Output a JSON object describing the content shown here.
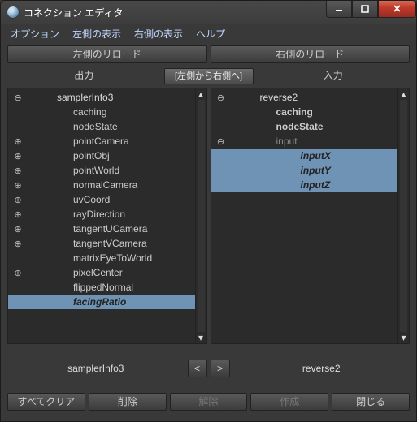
{
  "window": {
    "title": "コネクション エディタ"
  },
  "menu": {
    "options": "オプション",
    "left_display": "左側の表示",
    "right_display": "右側の表示",
    "help": "ヘルプ"
  },
  "toolbar": {
    "reload_left": "左側のリロード",
    "reload_right": "右側のリロード"
  },
  "columns": {
    "left": "出力",
    "center": "[左側から右側へ]",
    "right": "入力"
  },
  "left": {
    "node": "samplerInfo3",
    "attrs": [
      {
        "name": "caching",
        "exp": "",
        "bold": false
      },
      {
        "name": "nodeState",
        "exp": "",
        "bold": false
      },
      {
        "name": "pointCamera",
        "exp": "⊕",
        "bold": false
      },
      {
        "name": "pointObj",
        "exp": "⊕",
        "bold": false
      },
      {
        "name": "pointWorld",
        "exp": "⊕",
        "bold": false
      },
      {
        "name": "normalCamera",
        "exp": "⊕",
        "bold": false
      },
      {
        "name": "uvCoord",
        "exp": "⊕",
        "bold": false
      },
      {
        "name": "rayDirection",
        "exp": "⊕",
        "bold": false
      },
      {
        "name": "tangentUCamera",
        "exp": "⊕",
        "bold": false
      },
      {
        "name": "tangentVCamera",
        "exp": "⊕",
        "bold": false
      },
      {
        "name": "matrixEyeToWorld",
        "exp": "",
        "bold": false
      },
      {
        "name": "pixelCenter",
        "exp": "⊕",
        "bold": false
      },
      {
        "name": "flippedNormal",
        "exp": "",
        "bold": false
      },
      {
        "name": "facingRatio",
        "exp": "",
        "bold": true,
        "selected": true
      }
    ]
  },
  "right": {
    "node": "reverse2",
    "attrs": [
      {
        "name": "caching",
        "exp": "",
        "bold": true
      },
      {
        "name": "nodeState",
        "exp": "",
        "bold": true
      },
      {
        "name": "input",
        "exp": "⊖",
        "bold": false,
        "grey": true
      },
      {
        "name": "inputX",
        "sub": true,
        "selected": true
      },
      {
        "name": "inputY",
        "sub": true,
        "selected": true
      },
      {
        "name": "inputZ",
        "sub": true,
        "selected": true
      }
    ]
  },
  "footer": {
    "left_node": "samplerInfo3",
    "right_node": "reverse2",
    "prev": "<",
    "next": ">"
  },
  "buttons": {
    "clear_all": "すべてクリア",
    "delete": "削除",
    "release": "解除",
    "create": "作成",
    "close": "閉じる"
  }
}
